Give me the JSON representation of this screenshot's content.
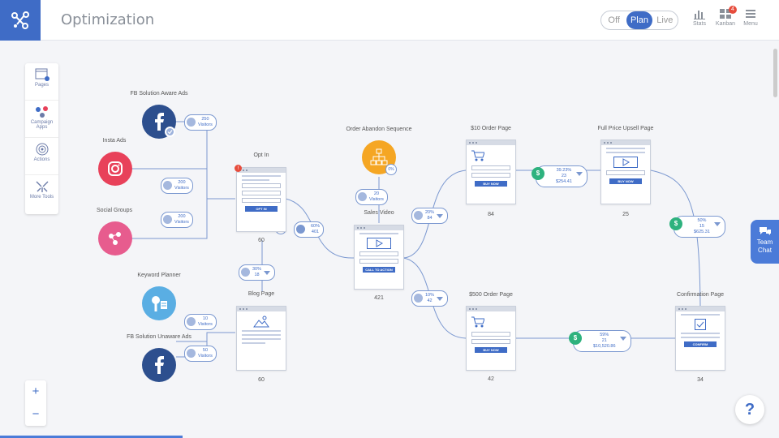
{
  "header": {
    "title": "Optimization",
    "modes": [
      "Off",
      "Plan",
      "Live"
    ],
    "active_mode": "Plan",
    "stats_label": "Stats",
    "kanban_label": "Kanban",
    "kanban_badge": "4",
    "menu_label": "Menu"
  },
  "toolbox": {
    "pages": "Pages",
    "campaign_apps": "Campaign Apps",
    "actions": "Actions",
    "more_tools": "More Tools"
  },
  "zoom": {
    "in": "+",
    "out": "−"
  },
  "team_chat": "Team Chat",
  "help": "?",
  "sources": {
    "fb_aware": "FB Solution Aware Ads",
    "insta": "Insta Ads",
    "social": "Social Groups",
    "keyword": "Keyword Planner",
    "fb_unaware": "FB Solution Unaware Ads",
    "order_abandon": "Order Abandon Sequence"
  },
  "pages": {
    "optin": {
      "label": "Opt In",
      "count": "60",
      "button": "OPT IN"
    },
    "blog": {
      "label": "Blog Page",
      "count": "60"
    },
    "sales": {
      "label": "Sales Video",
      "count": "421",
      "button": "CALL TO ACTION"
    },
    "order10": {
      "label": "$10 Order Page",
      "count": "84",
      "button": "BUY NOW"
    },
    "order500": {
      "label": "$500 Order Page",
      "count": "42",
      "button": "BUY NOW"
    },
    "upsell": {
      "label": "Full Price Upsell Page",
      "count": "25",
      "button": "BUY NOW"
    },
    "confirm": {
      "label": "Confirmation Page",
      "count": "34",
      "button": "CONFIRM"
    }
  },
  "stats": {
    "fb_aware": {
      "v": "250",
      "l": "Visitors"
    },
    "insta": {
      "v": "200",
      "l": "Visitors"
    },
    "social": {
      "v": "200",
      "l": "Visitors"
    },
    "keyword": {
      "v": "10",
      "l": "Visitors"
    },
    "fb_unaware": {
      "v": "50",
      "l": "Visitors"
    },
    "abandon": {
      "v": "20",
      "l": "Visitors"
    },
    "optin_sales": {
      "v": "60%",
      "l": "401"
    },
    "blog_optin": {
      "v": "30%",
      "l": "18"
    },
    "sales_10": {
      "v": "20%",
      "l": "84"
    },
    "sales_500": {
      "v": "10%",
      "l": "42"
    },
    "optin_zero": "0%",
    "abandon_zero": "0%"
  },
  "money": {
    "m10": {
      "p": "39.23%",
      "n": "23",
      "t": "$254.41"
    },
    "upsell": {
      "p": "50%",
      "n": "15",
      "t": "$625.31"
    },
    "m500": {
      "p": "59%",
      "n": "21",
      "t": "$10,520.86"
    }
  },
  "colors": {
    "accent": "#3f6cc6",
    "facebook": "#2d4f8e",
    "instagram": "#e8415a",
    "social": "#e75c8e",
    "keyword": "#5aaee3",
    "abandon": "#f5a623",
    "money": "#2eb27e"
  }
}
